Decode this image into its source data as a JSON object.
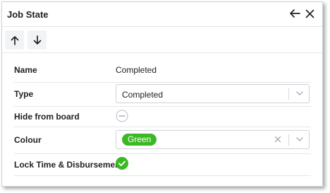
{
  "dialog": {
    "title": "Job State"
  },
  "fields": {
    "name": {
      "label": "Name",
      "value": "Completed"
    },
    "type": {
      "label": "Type",
      "value": "Completed"
    },
    "hide_from_board": {
      "label": "Hide from board",
      "checked": false
    },
    "colour": {
      "label": "Colour",
      "value": "Green",
      "color": "#3cb825"
    },
    "lock_time": {
      "label": "Lock Time & Disbursements",
      "checked": true,
      "color": "#3cb825"
    }
  },
  "icons": {
    "back": "arrow-left-icon",
    "close": "close-icon",
    "up": "arrow-up-icon",
    "down": "arrow-down-icon"
  }
}
